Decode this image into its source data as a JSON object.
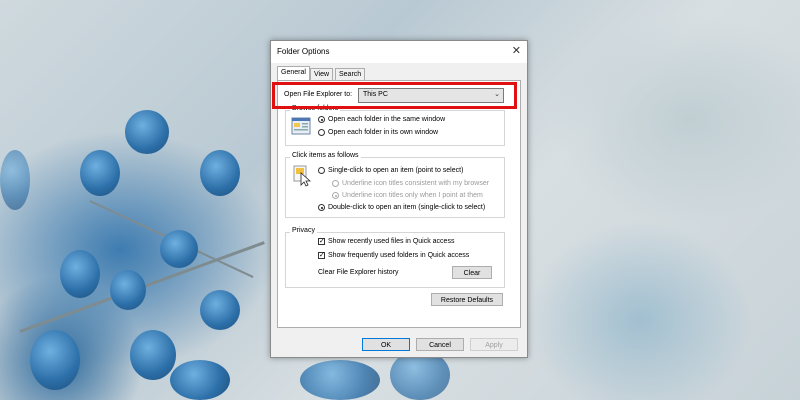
{
  "dialog": {
    "title": "Folder Options",
    "close_glyph": "✕",
    "tabs": [
      {
        "label": "General",
        "active": true
      },
      {
        "label": "View",
        "active": false
      },
      {
        "label": "Search",
        "active": false
      }
    ],
    "open_explorer": {
      "label": "Open File Explorer to:",
      "value": "This PC",
      "arrow": "⌄"
    },
    "browse_folders": {
      "title": "Browse folders",
      "options": [
        {
          "label": "Open each folder in the same window",
          "checked": true
        },
        {
          "label": "Open each folder in its own window",
          "checked": false
        }
      ]
    },
    "click_items": {
      "title": "Click items as follows",
      "options": [
        {
          "label": "Single-click to open an item (point to select)",
          "checked": false,
          "disabled": false
        },
        {
          "label": "Underline icon titles consistent with my browser",
          "checked": false,
          "disabled": true
        },
        {
          "label": "Underline icon titles only when I point at them",
          "checked": true,
          "disabled": true
        },
        {
          "label": "Double-click to open an item (single-click to select)",
          "checked": true,
          "disabled": false
        }
      ]
    },
    "privacy": {
      "title": "Privacy",
      "checks": [
        {
          "label": "Show recently used files in Quick access",
          "checked": true
        },
        {
          "label": "Show frequently used folders in Quick access",
          "checked": true
        }
      ],
      "clear_label": "Clear File Explorer history",
      "clear_button": "Clear"
    },
    "restore_button": "Restore Defaults",
    "buttons": {
      "ok": "OK",
      "cancel": "Cancel",
      "apply": "Apply"
    }
  },
  "colors": {
    "highlight": "#e01010",
    "accent": "#0078d7"
  }
}
